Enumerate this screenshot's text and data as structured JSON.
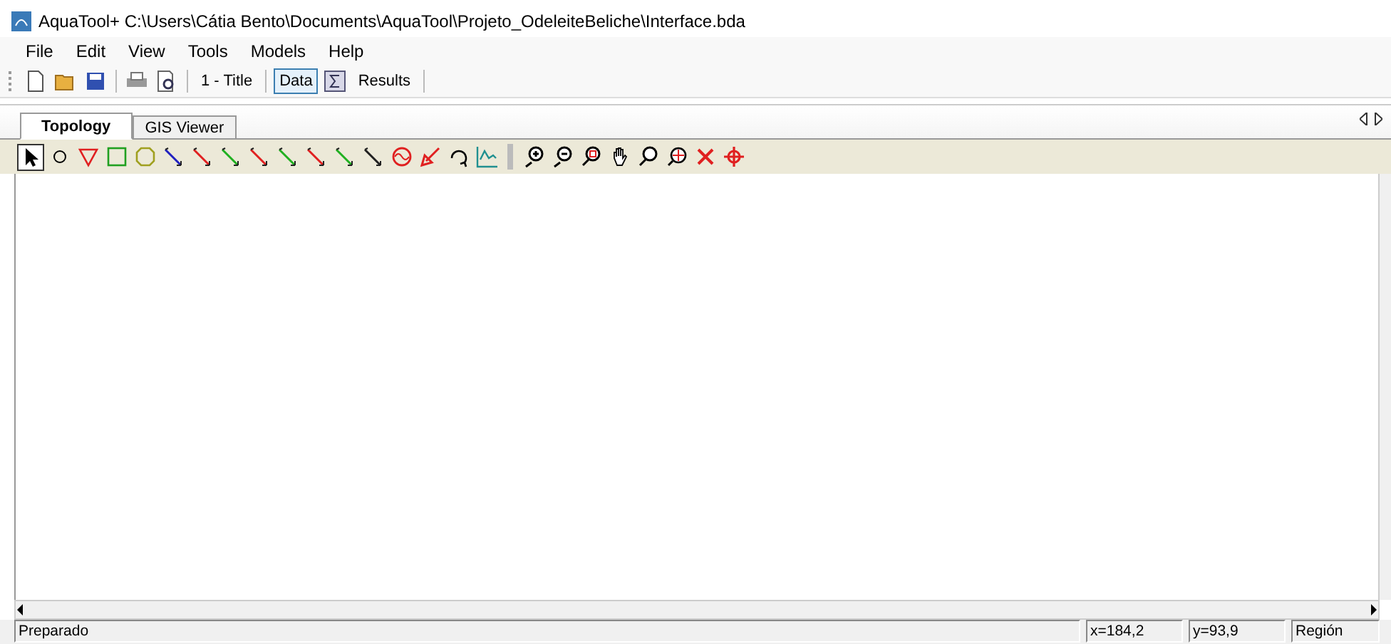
{
  "window": {
    "title": "AquaTool+ C:\\Users\\Cátia Bento\\Documents\\AquaTool\\Projeto_OdeleiteBeliche\\Interface.bda"
  },
  "menu": [
    "File",
    "Edit",
    "View",
    "Tools",
    "Models",
    "Help"
  ],
  "toolbar": [
    {
      "kind": "new"
    },
    {
      "kind": "open"
    },
    {
      "kind": "save"
    },
    {
      "kind": "sep"
    },
    {
      "kind": "print"
    },
    {
      "kind": "preview"
    },
    {
      "kind": "sep"
    },
    {
      "kind": "text",
      "label": "1 - Title",
      "selected": false
    },
    {
      "kind": "sep"
    },
    {
      "kind": "text",
      "label": "Data",
      "selected": true
    },
    {
      "kind": "sigma"
    },
    {
      "kind": "text",
      "label": "Results",
      "selected": false
    },
    {
      "kind": "sep"
    }
  ],
  "tabs": [
    {
      "label": "Topology",
      "selected": true
    },
    {
      "label": "GIS Viewer",
      "selected": false
    }
  ],
  "tools": [
    {
      "kind": "pointer",
      "selected": true
    },
    {
      "kind": "circle",
      "selected": false
    },
    {
      "kind": "triangle",
      "selected": false
    },
    {
      "kind": "square",
      "selected": false
    },
    {
      "kind": "octagon",
      "selected": false
    },
    {
      "kind": "link",
      "color": "#2020c0",
      "selected": false
    },
    {
      "kind": "link",
      "color": "#e02020",
      "selected": false
    },
    {
      "kind": "link",
      "color": "#20b020",
      "selected": false
    },
    {
      "kind": "link",
      "color": "#e02020",
      "selected": false
    },
    {
      "kind": "link",
      "color": "#20b020",
      "selected": false
    },
    {
      "kind": "link",
      "color": "#e02020",
      "selected": false
    },
    {
      "kind": "link",
      "color": "#20b020",
      "selected": false
    },
    {
      "kind": "link",
      "color": "#202020",
      "selected": false
    },
    {
      "kind": "gauge",
      "selected": false
    },
    {
      "kind": "diagonal",
      "selected": false
    },
    {
      "kind": "curve",
      "selected": false
    },
    {
      "kind": "chart",
      "selected": false
    },
    {
      "kind": "sep"
    },
    {
      "kind": "zoom-in",
      "selected": false
    },
    {
      "kind": "zoom-out",
      "selected": false
    },
    {
      "kind": "zoom-box",
      "selected": false
    },
    {
      "kind": "hand",
      "selected": false
    },
    {
      "kind": "zoom",
      "selected": false
    },
    {
      "kind": "zoom-target",
      "selected": false
    },
    {
      "kind": "delete",
      "selected": false
    },
    {
      "kind": "crosshair",
      "selected": false
    }
  ],
  "status": {
    "message": "Preparado",
    "x": "x=184,2",
    "y": "y=93,9",
    "mode": "Región"
  }
}
